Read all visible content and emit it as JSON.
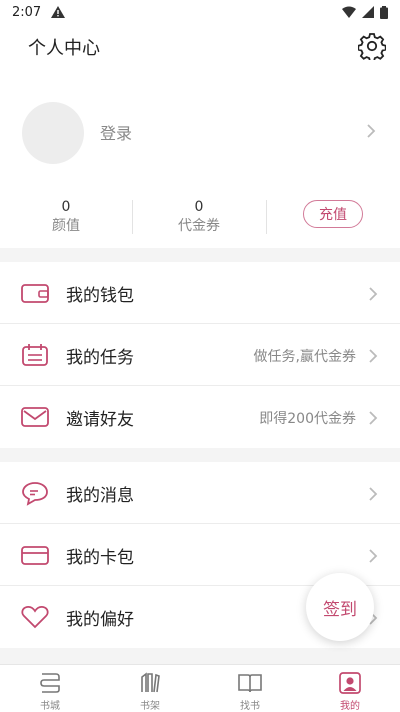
{
  "status": {
    "time": "2:07"
  },
  "header": {
    "title": "个人中心"
  },
  "profile": {
    "login_label": "登录"
  },
  "stats": {
    "beauty": {
      "value": "0",
      "label": "颜值"
    },
    "voucher": {
      "value": "0",
      "label": "代金券"
    },
    "recharge_label": "充值"
  },
  "menu": {
    "wallet": {
      "label": "我的钱包"
    },
    "tasks": {
      "label": "我的任务",
      "hint": "做任务,赢代金券"
    },
    "invite": {
      "label": "邀请好友",
      "hint": "即得200代金券"
    },
    "messages": {
      "label": "我的消息"
    },
    "cards": {
      "label": "我的卡包"
    },
    "preferences": {
      "label": "我的偏好"
    }
  },
  "checkin_label": "签到",
  "tabs": [
    {
      "label": "书城",
      "icon": "bookstore-icon"
    },
    {
      "label": "书架",
      "icon": "bookshelf-icon"
    },
    {
      "label": "找书",
      "icon": "open-book-icon"
    },
    {
      "label": "我的",
      "icon": "profile-icon"
    }
  ],
  "colors": {
    "accent": "#c2496f",
    "background": "#f4f4f4"
  }
}
